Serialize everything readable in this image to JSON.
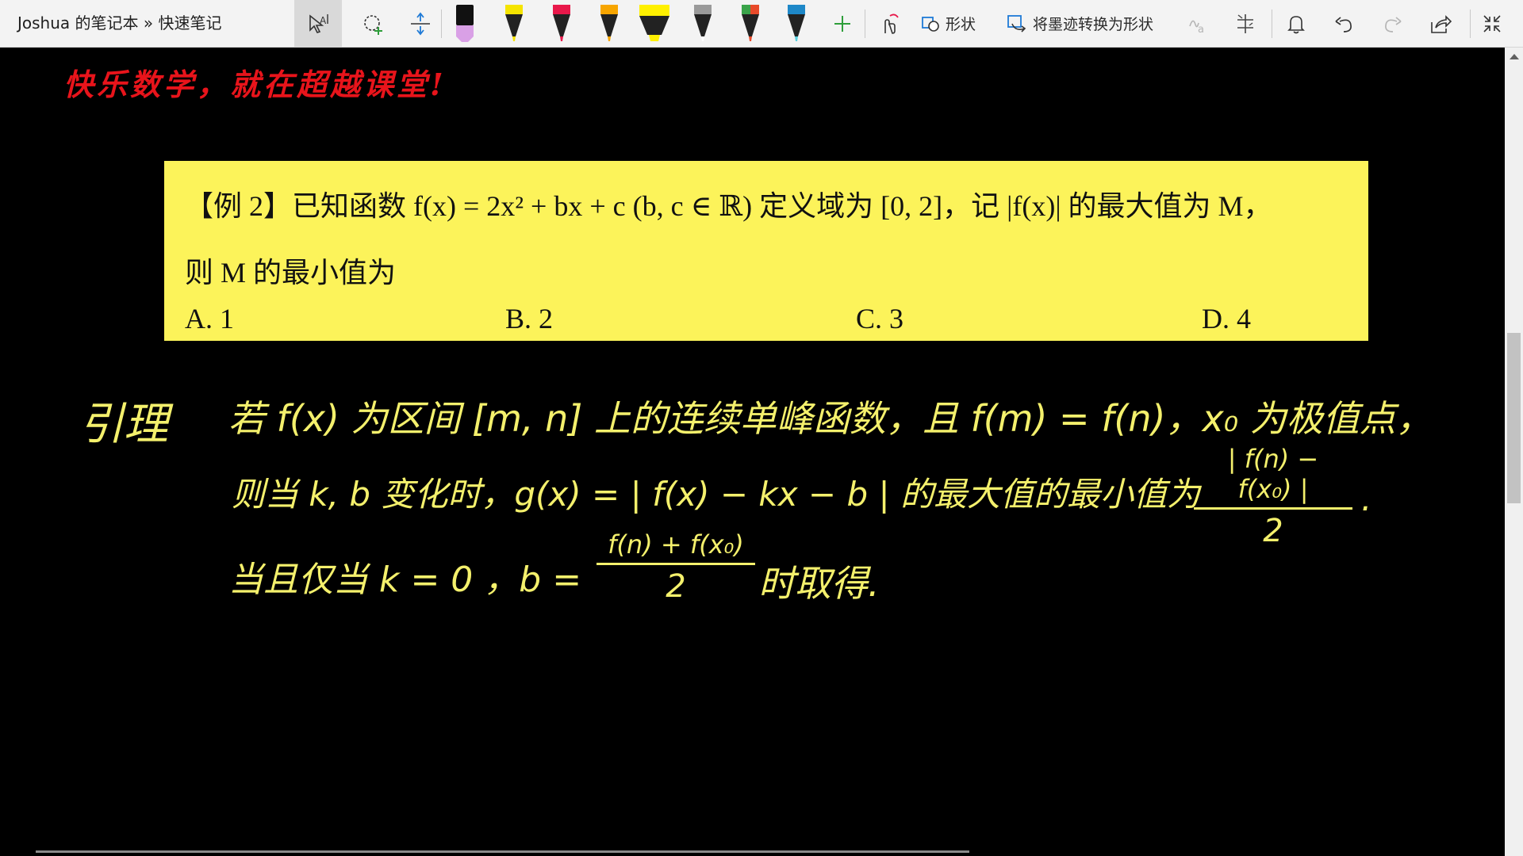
{
  "window": {
    "title": "Joshua 的笔记本 » 快速笔记"
  },
  "toolbar": {
    "shapes_label": "形状",
    "ink_to_shape_label": "将墨迹转换为形状",
    "pens": [
      {
        "name": "pen-black",
        "color": "#111111",
        "tip": "#d9a0e6"
      },
      {
        "name": "pen-yellow",
        "color": "#f5e400",
        "tip": "#f5e400"
      },
      {
        "name": "pen-red",
        "color": "#e8184a",
        "tip": "#e8184a"
      },
      {
        "name": "pen-orange",
        "color": "#f7a500",
        "tip": "#f7a500"
      },
      {
        "name": "highlighter-yellow",
        "color": "#fff000",
        "tip": "#fff000"
      },
      {
        "name": "pen-galaxy",
        "color": "#8a8a8a",
        "tip": "#ffffff"
      },
      {
        "name": "pen-rainbow",
        "color": "#3aa34a",
        "tip": "#e84a2a"
      },
      {
        "name": "pen-ocean",
        "color": "#1e88c8",
        "tip": "#58d0e0"
      }
    ]
  },
  "note": {
    "slogan": "快乐数学，就在超越课堂!",
    "problem": {
      "line1": "【例 2】已知函数 f(x) = 2x² + bx + c (b, c ∈ ℝ) 定义域为 [0, 2]，记 |f(x)| 的最大值为 M，",
      "line2": "则 M 的最小值为",
      "options": [
        "A.  1",
        "B.  2",
        "C.  3",
        "D.  4"
      ]
    },
    "handwriting": {
      "lemma_label": "引理",
      "line1": "若 f(x) 为区间 [m, n] 上的连续单峰函数，且 f(m) = f(n)，x₀ 为极值点，",
      "line2": "则当 k, b 变化时，g(x) = | f(x) − kx − b | 的最大值的最小值为",
      "frac1_num": "| f(n) − f(x₀) |",
      "frac1_den": "2",
      "line3": "当且仅当 k = 0 ，b =",
      "frac2_num": "f(n) + f(x₀)",
      "frac2_den": "2",
      "line3_end": "时取得."
    }
  }
}
